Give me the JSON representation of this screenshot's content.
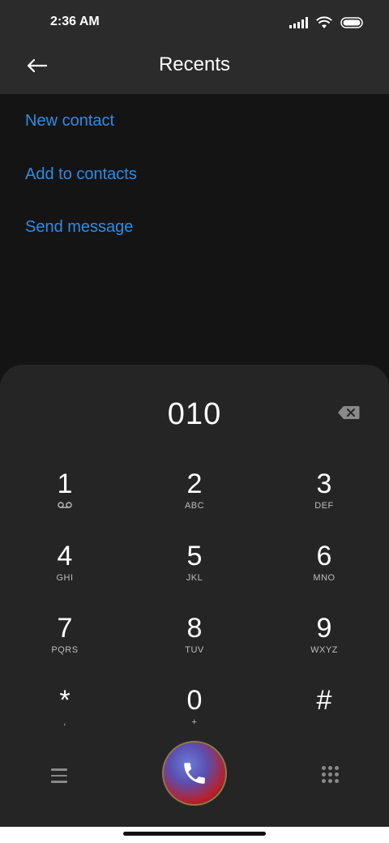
{
  "status_bar": {
    "time": "2:36 AM",
    "icons": [
      "signal-icon",
      "wifi-icon",
      "battery-icon"
    ]
  },
  "header": {
    "title": "Recents",
    "back_icon": "back-arrow-icon"
  },
  "actions": [
    {
      "label": "New contact"
    },
    {
      "label": "Add to contacts"
    },
    {
      "label": "Send message"
    }
  ],
  "dialer": {
    "number": "010",
    "keys": [
      {
        "digit": "1",
        "sub": ""
      },
      {
        "digit": "2",
        "sub": "ABC"
      },
      {
        "digit": "3",
        "sub": "DEF"
      },
      {
        "digit": "4",
        "sub": "GHI"
      },
      {
        "digit": "5",
        "sub": "JKL"
      },
      {
        "digit": "6",
        "sub": "MNO"
      },
      {
        "digit": "7",
        "sub": "PQRS"
      },
      {
        "digit": "8",
        "sub": "TUV"
      },
      {
        "digit": "9",
        "sub": "WXYZ"
      },
      {
        "digit": "*",
        "sub": ","
      },
      {
        "digit": "0",
        "sub": "+"
      },
      {
        "digit": "#",
        "sub": ""
      }
    ]
  },
  "colors": {
    "accent": "#2b8ce6",
    "sheet": "#252525",
    "header": "#2b2b2b",
    "background": "#141414"
  }
}
